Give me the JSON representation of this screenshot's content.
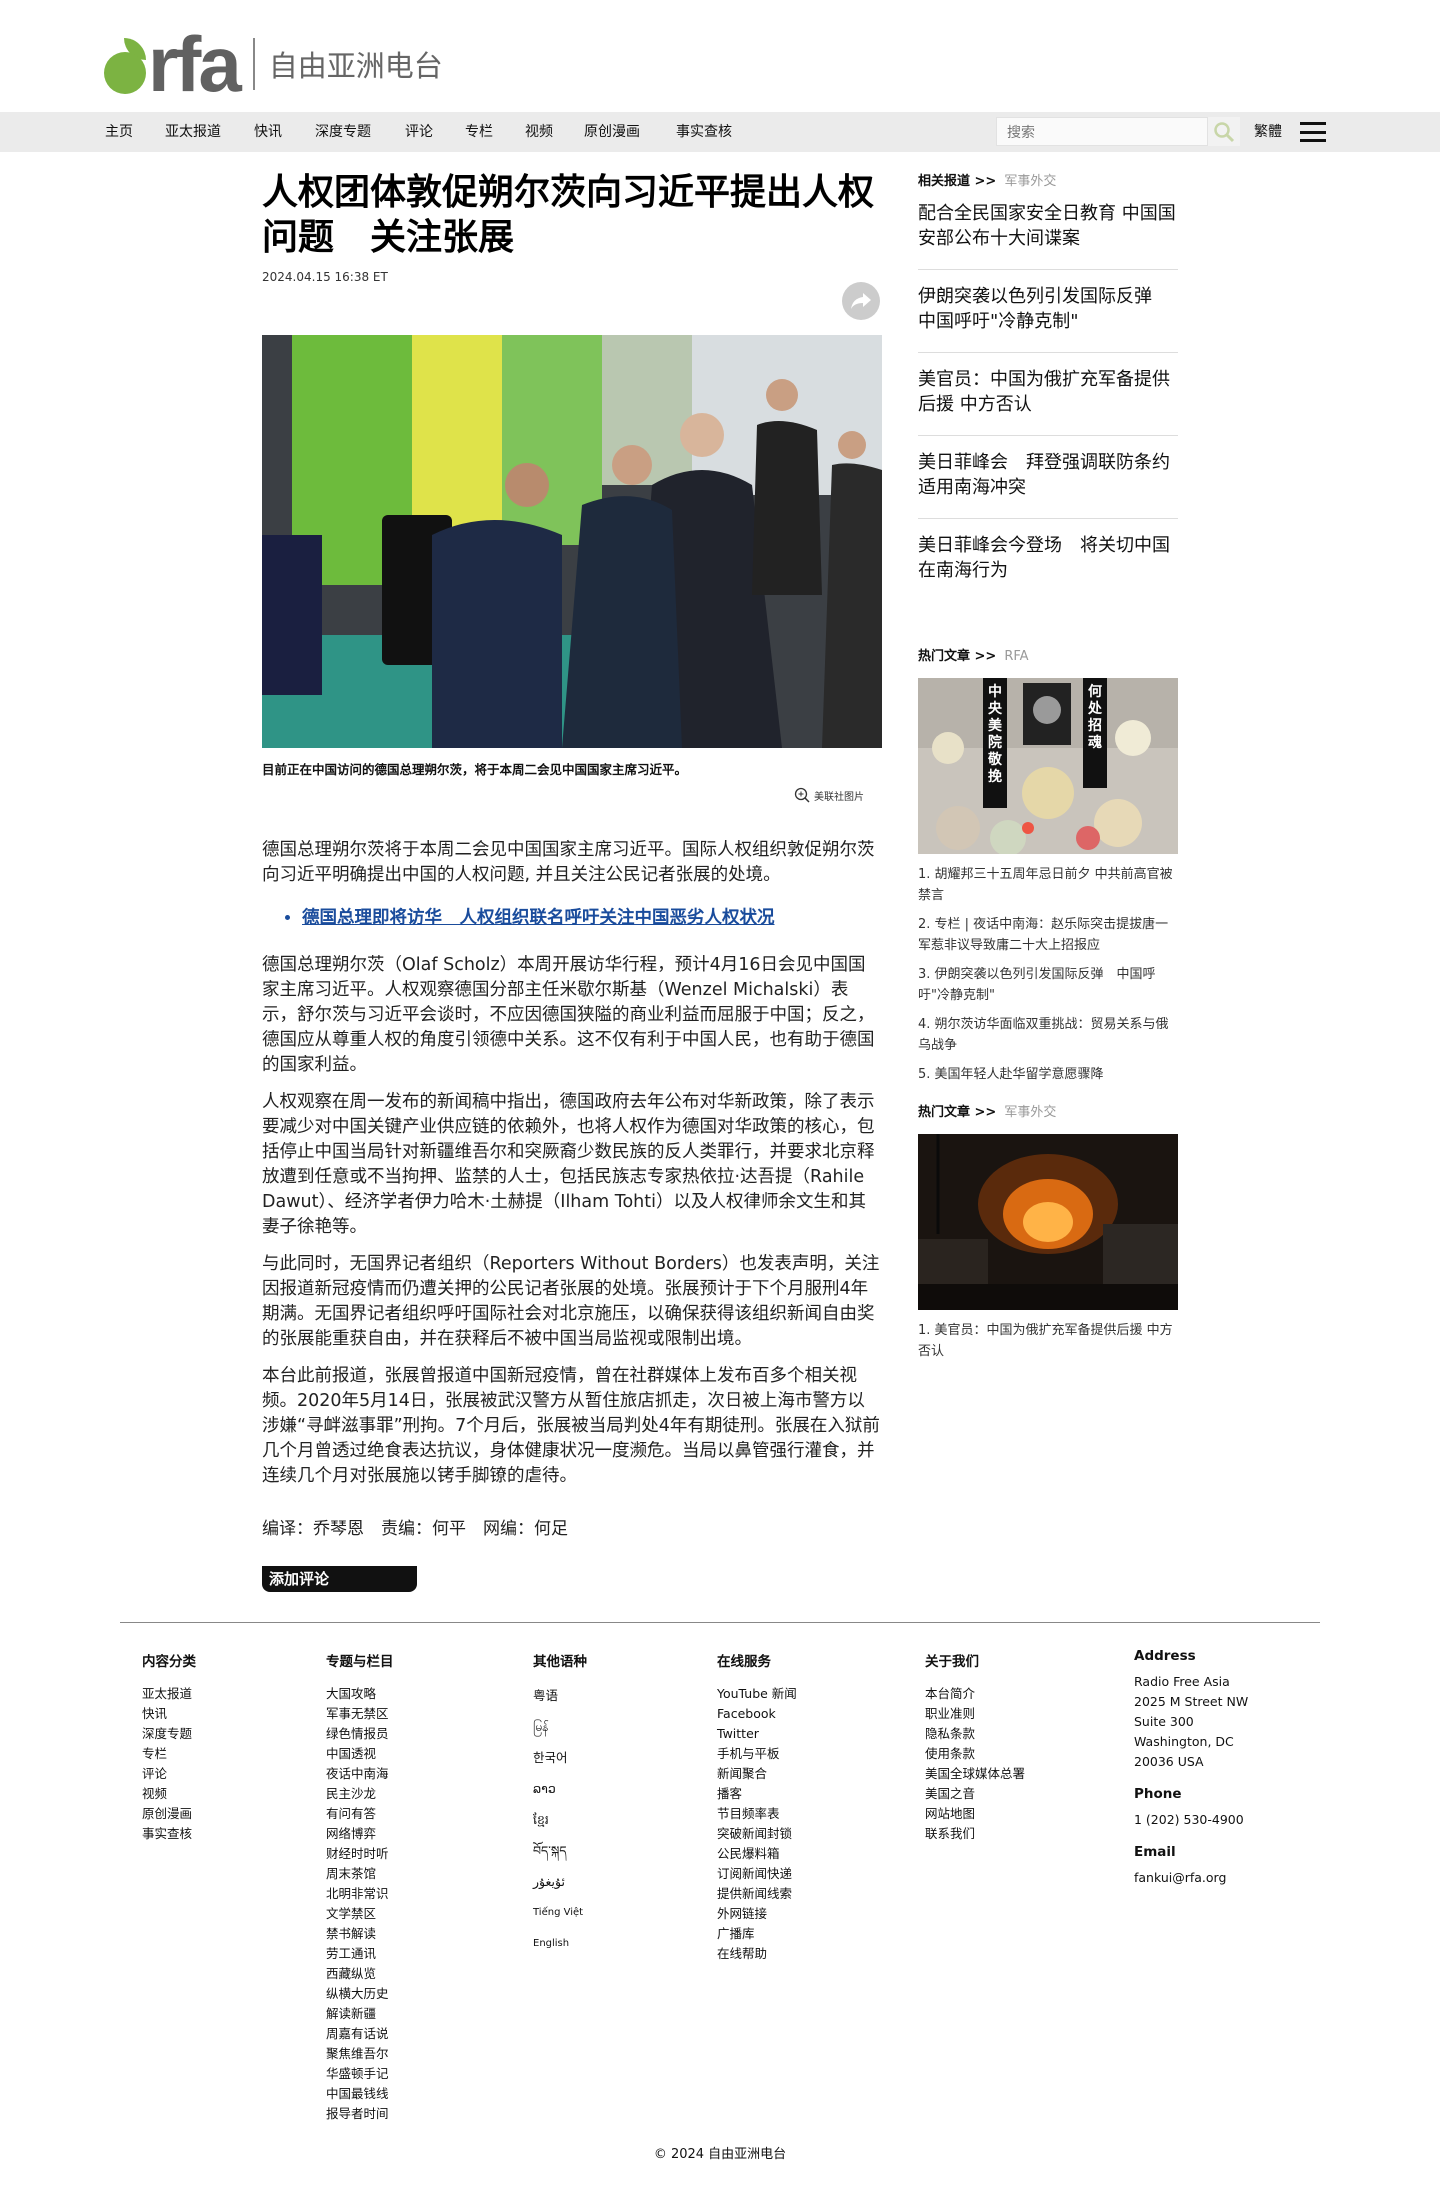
{
  "header": {
    "logo_text": "rfa",
    "site_name": "自由亚洲电台"
  },
  "nav": {
    "items": [
      "主页",
      "亚太报道",
      "快讯",
      "深度专题",
      "评论",
      "专栏",
      "视频",
      "原创漫画",
      "事实查核"
    ],
    "search_placeholder": "搜索",
    "lang_switch": "繁體",
    "menu_icon": "hamburger-icon",
    "search_icon": "search-icon"
  },
  "article": {
    "title": "人权团体敦促朔尔茨向习近平提出人权问题　关注张展",
    "date": "2024.04.15 16:38 ET",
    "share_icon": "share-icon",
    "caption": "目前正在中国访问的德国总理朔尔茨，将于本周二会见中国国家主席习近平。",
    "credit": "美联社图片",
    "paragraphs": [
      "德国总理朔尔茨将于本周二会见中国国家主席习近平。国际人权组织敦促朔尔茨向习近平明确提出中国的人权问题, 并且关注公民记者张展的处境。",
      "德国总理朔尔茨（Olaf Scholz）本周开展访华行程，预计4月16日会见中国国家主席习近平。人权观察德国分部主任米歇尔斯基（Wenzel Michalski）表示，舒尔茨与习近平会谈时，不应因德国狭隘的商业利益而屈服于中国；反之，德国应从尊重人权的角度引领德中关系。这不仅有利于中国人民，也有助于德国的国家利益。",
      "人权观察在周一发布的新闻稿中指出，德国政府去年公布对华新政策，除了表示要减少对中国关键产业供应链的依赖外，也将人权作为德国对华政策的核心，包括停止中国当局针对新疆维吾尔和突厥裔少数民族的反人类罪行，并要求北京释放遭到任意或不当拘押、监禁的人士，包括民族志专家热依拉·达吾提（Rahile Dawut）、经济学者伊力哈木·土赫提（Ilham Tohti）以及人权律师余文生和其妻子徐艳等。",
      "与此同时，无国界记者组织（Reporters Without Borders）也发表声明，关注因报道新冠疫情而仍遭关押的公民记者张展的处境。张展预计于下个月服刑4年期满。无国界记者组织呼吁国际社会对北京施压，以确保获得该组织新闻自由奖的张展能重获自由，并在获释后不被中国当局监视或限制出境。",
      "本台此前报道，张展曾报道中国新冠疫情，曾在社群媒体上发布百多个相关视频。2020年5月14日，张展被武汉警方从暂住旅店抓走，次日被上海市警方以涉嫌“寻衅滋事罪”刑拘。7个月后，张展被当局判处4年有期徒刑。张展在入狱前几个月曾透过绝食表达抗议，身体健康状况一度濒危。当局以鼻管强行灌食，并连续几个月对张展施以铐手脚镣的虐待。"
    ],
    "related_link": "德国总理即将访华　人权组织联名呼吁关注中国恶劣人权状况",
    "editors": "编译：乔琴恩　责编：何平　网编：何足",
    "comment_button": "添加评论"
  },
  "sidebar": {
    "related_head": "相关报道 >>",
    "related_sub": "军事外交",
    "related": [
      "配合全民国家安全日教育 中国国安部公布十大间谍案",
      "伊朗突袭以色列引发国际反弹　中国呼吁\"冷静克制\"",
      "美官员：中国为俄扩充军备提供后援 中方否认",
      "美日菲峰会　拜登强调联防条约适用南海冲突",
      "美日菲峰会今登场　将关切中国在南海行为"
    ],
    "hot1_head": "热门文章 >>",
    "hot1_sub": "RFA",
    "hot1_image_text": [
      "中央美院敬挽",
      "何处招魂"
    ],
    "hot1": [
      "1. 胡耀邦三十五周年忌日前夕 中共前高官被禁言",
      "2. 专栏 | 夜话中南海：赵乐际突击提拔唐一军惹非议导致庸二十大上招报应",
      "3. 伊朗突袭以色列引发国际反弹　中国呼吁\"冷静克制\"",
      "4. 朔尔茨访华面临双重挑战：贸易关系与俄乌战争",
      "5. 美国年轻人赴华留学意愿骤降"
    ],
    "hot2_head": "热门文章 >>",
    "hot2_sub": "军事外交",
    "hot2": [
      "1. 美官员：中国为俄扩充军备提供后援 中方否认"
    ]
  },
  "footer": {
    "col1": {
      "head": "内容分类",
      "items": [
        "亚太报道",
        "快讯",
        "深度专题",
        "专栏",
        "评论",
        "视频",
        "原创漫画",
        "事实查核"
      ]
    },
    "col2": {
      "head": "专题与栏目",
      "items": [
        "大国攻略",
        "军事无禁区",
        "绿色情报员",
        "中国透视",
        "夜话中南海",
        "民主沙龙",
        "有问有答",
        "网络博弈",
        "财经时时听",
        "周末茶馆",
        "北明非常识",
        "文学禁区",
        "禁书解读",
        "劳工通讯",
        "西藏纵览",
        "纵横大历史",
        "解读新疆",
        "周嘉有话说",
        "聚焦维吾尔",
        "华盛顿手记",
        "中国最钱线",
        "报导者时间"
      ]
    },
    "col3": {
      "head": "其他语种",
      "items": [
        "粤语",
        "မြန်",
        "한국어",
        "ລາວ",
        "ខ្មែរ",
        "བོད་སྐད",
        "ئۇيغۇر",
        "Tiếng Việt",
        "English"
      ]
    },
    "col4": {
      "head": "在线服务",
      "items": [
        "YouTube 新闻",
        "Facebook",
        "Twitter",
        "手机与平板",
        "新闻聚合",
        "播客",
        "节目频率表",
        "突破新闻封锁",
        "公民爆料箱",
        "订阅新闻快递",
        "提供新闻线索",
        "外网链接",
        "广播库",
        "在线帮助"
      ]
    },
    "col5": {
      "head": "关于我们",
      "items": [
        "本台简介",
        "职业准则",
        "隐私条款",
        "使用条款",
        "美国全球媒体总署",
        "美国之音",
        "网站地图",
        "联系我们"
      ]
    },
    "col6": {
      "head": "Address",
      "address": [
        "Radio Free Asia",
        "2025 M Street NW",
        "Suite 300",
        "Washington, DC",
        "20036 USA"
      ],
      "phone_head": "Phone",
      "phone": "1 (202) 530-4900",
      "email_head": "Email",
      "email": "fankui@rfa.org"
    },
    "copyright": "© 2024 自由亚洲电台"
  },
  "colors": {
    "brand_green": "#7cb342",
    "nav_bg": "#ebebeb",
    "link_blue": "#1a4c9c"
  }
}
